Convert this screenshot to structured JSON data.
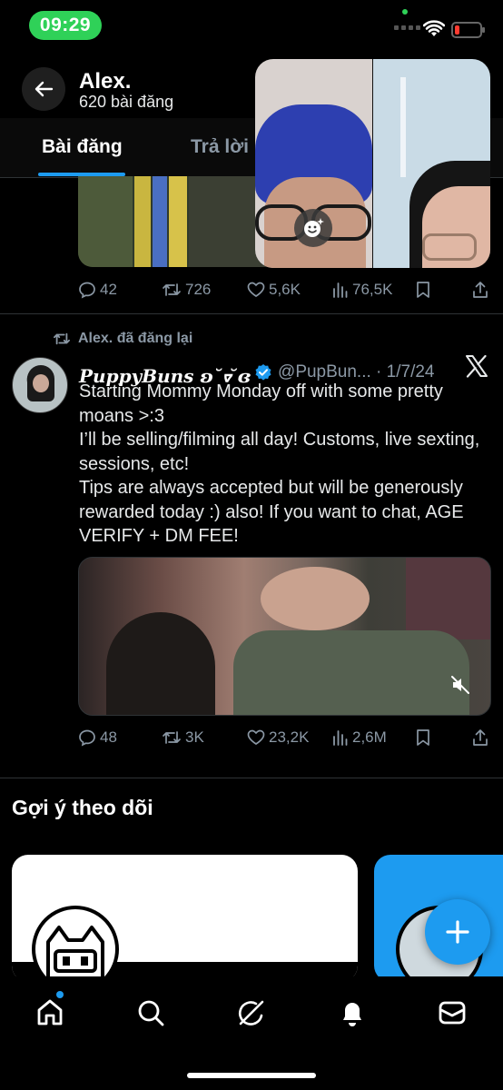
{
  "status_bar": {
    "time": "09:29",
    "battery_level": 0.2
  },
  "header": {
    "name": "Alex.",
    "post_count": "620 bài đăng"
  },
  "tabs": [
    {
      "label": "Bài đăng",
      "active": true
    },
    {
      "label": "Trả lời",
      "active": false
    }
  ],
  "tweet1": {
    "replies": "42",
    "reposts": "726",
    "likes": "5,6K",
    "views": "76,5K"
  },
  "tweet2": {
    "repost_label": "Alex. đã đăng lại",
    "display_name": "PuppyBuns ʚ˘ᢦ ̆ɞ",
    "handle_date": "@PupBun... · 1/7/24",
    "verified": true,
    "text_lines": [
      "Starting Mommy Monday off with some pretty moans >:3",
      "I’ll be selling/filming all day! Customs, live sexting, sessions, etc!",
      "Tips are always accepted but will be generously rewarded today :) also! If you want to chat, AGE VERIFY + DM FEE!"
    ],
    "replies": "48",
    "reposts": "3K",
    "likes": "23,2K",
    "views": "2,6M"
  },
  "suggestions": {
    "title": "Gợi ý theo dõi"
  },
  "bottom_nav": {
    "items": [
      "home-icon",
      "search-icon",
      "grok-icon",
      "bell-icon",
      "mail-icon"
    ],
    "active": "home-icon"
  },
  "colors": {
    "accent": "#1d9bf0",
    "background": "#000000",
    "muted_text": "#8b98a5",
    "status_green": "#2fd158"
  }
}
